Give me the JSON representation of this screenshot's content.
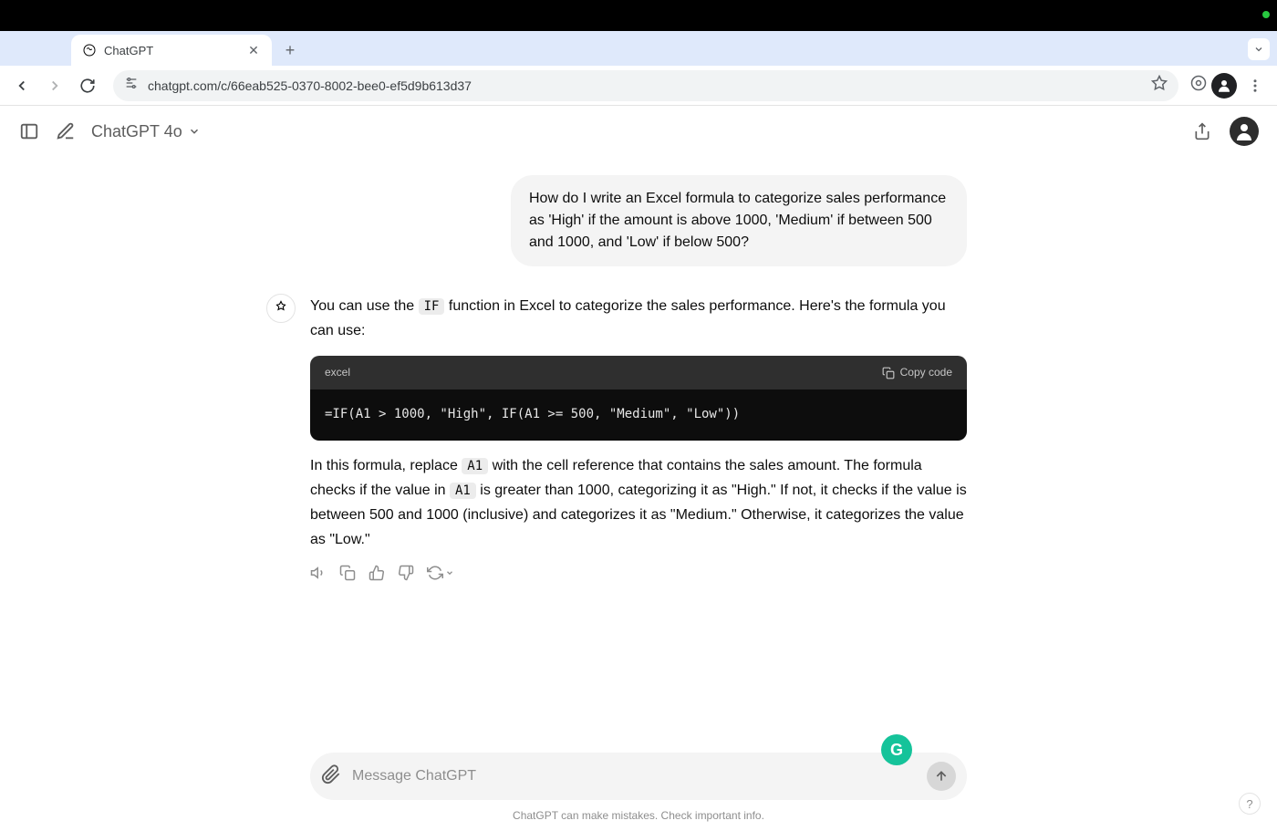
{
  "browser": {
    "tab_title": "ChatGPT",
    "url": "chatgpt.com/c/66eab525-0370-8002-bee0-ef5d9b613d37"
  },
  "header": {
    "model": "ChatGPT 4o"
  },
  "chat": {
    "user_message": "How do I write an Excel formula to categorize sales performance as 'High' if the amount is above 1000, 'Medium' if between 500 and 1000, and 'Low' if below 500?",
    "assistant": {
      "p1_a": "You can use the ",
      "p1_code": "IF",
      "p1_b": " function in Excel to categorize the sales performance. Here's the formula you can use:",
      "code_lang": "excel",
      "copy_label": "Copy code",
      "code_content": "=IF(A1 > 1000, \"High\", IF(A1 >= 500, \"Medium\", \"Low\"))",
      "p2_a": "In this formula, replace ",
      "p2_code1": "A1",
      "p2_b": " with the cell reference that contains the sales amount. The formula checks if the value in ",
      "p2_code2": "A1",
      "p2_c": " is greater than 1000, categorizing it as \"High.\" If not, it checks if the value is between 500 and 1000 (inclusive) and categorizes it as \"Medium.\" Otherwise, it categorizes the value as \"Low.\""
    }
  },
  "input": {
    "placeholder": "Message ChatGPT"
  },
  "footer": {
    "disclaimer": "ChatGPT can make mistakes. Check important info."
  },
  "grammarly_letter": "G",
  "help_label": "?"
}
